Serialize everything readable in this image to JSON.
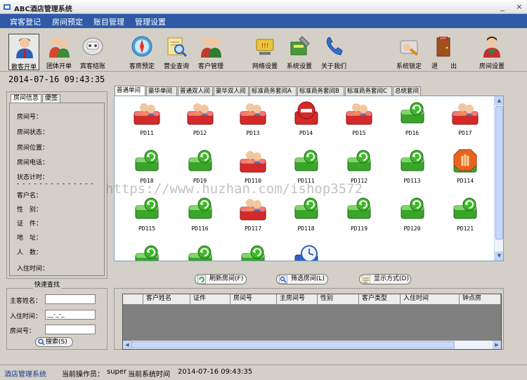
{
  "window": {
    "title": "ABC酒店管理系统",
    "minimize": "_",
    "close": "×"
  },
  "menu": [
    "宾客登记",
    "房间预定",
    "账目管理",
    "管理设置"
  ],
  "toolbar": [
    {
      "label": "散客开单",
      "icon": "walkin-guest-icon"
    },
    {
      "label": "团体开单",
      "icon": "group-guest-icon"
    },
    {
      "label": "宾客结账",
      "icon": "checkout-icon"
    },
    {
      "label": "客房预定",
      "icon": "compass-icon"
    },
    {
      "label": "营业查询",
      "icon": "search-report-icon"
    },
    {
      "label": "客户管理",
      "icon": "customer-icon"
    },
    {
      "label": "网络设置",
      "icon": "network-icon"
    },
    {
      "label": "系统设置",
      "icon": "settings-icon"
    },
    {
      "label": "关于我们",
      "icon": "info-icon"
    },
    {
      "label": "系统锁定",
      "icon": "lock-icon"
    },
    {
      "label": "退　　出",
      "icon": "exit-icon"
    },
    {
      "label": "房间设置",
      "icon": "room-settings-icon"
    }
  ],
  "datetime": "2014-07-16 09:43:35",
  "left_tabs": [
    "房间信息",
    "便签"
  ],
  "room_info_fields": [
    "房间号：",
    "房间状态：",
    "房间位置：",
    "房间电话：",
    "状态计时："
  ],
  "separator": "- - - - - - - - - - - - - -",
  "guest_info_fields": [
    "客户名：",
    "性　别：",
    "证　件：",
    "地　址：",
    "人　数：",
    "入住时间："
  ],
  "quick_search": {
    "title": "快速查找",
    "fields": [
      {
        "label": "主客姓名：",
        "value": ""
      },
      {
        "label": "入住时间：",
        "value": "__-_-_"
      },
      {
        "label": "房间号：",
        "value": ""
      }
    ],
    "button": "搜索(S)"
  },
  "room_tabs": [
    "普通单间",
    "豪华单间",
    "普通双人间",
    "豪华双人间",
    "标准商务套间A",
    "标准商务套间B",
    "标准商务套间C",
    "总统套间"
  ],
  "rooms": [
    {
      "id": "PD11",
      "status": "occupied"
    },
    {
      "id": "PD12",
      "status": "occupied"
    },
    {
      "id": "PD13",
      "status": "occupied"
    },
    {
      "id": "PD14",
      "status": "blocked"
    },
    {
      "id": "PD15",
      "status": "occupied"
    },
    {
      "id": "PD16",
      "status": "vacant"
    },
    {
      "id": "PD17",
      "status": "occupied"
    },
    {
      "id": "PD18",
      "status": "vacant"
    },
    {
      "id": "PD19",
      "status": "vacant"
    },
    {
      "id": "PD110",
      "status": "occupied"
    },
    {
      "id": "PD111",
      "status": "vacant"
    },
    {
      "id": "PD112",
      "status": "vacant"
    },
    {
      "id": "PD113",
      "status": "vacant"
    },
    {
      "id": "PD114",
      "status": "stop"
    },
    {
      "id": "PD115",
      "status": "vacant"
    },
    {
      "id": "PD116",
      "status": "vacant"
    },
    {
      "id": "PD117",
      "status": "occupied"
    },
    {
      "id": "PD118",
      "status": "vacant"
    },
    {
      "id": "PD119",
      "status": "vacant"
    },
    {
      "id": "PD120",
      "status": "vacant"
    },
    {
      "id": "PD121",
      "status": "vacant"
    },
    {
      "id": "",
      "status": "vacant"
    },
    {
      "id": "",
      "status": "vacant"
    },
    {
      "id": "",
      "status": "vacant"
    },
    {
      "id": "",
      "status": "reserved"
    }
  ],
  "actions": [
    {
      "label": "刷新房间(F)"
    },
    {
      "label": "筛选房间(L)"
    },
    {
      "label": "显示方式(D)"
    }
  ],
  "guest_table_headers": [
    "客户姓名",
    "证件",
    "房间号",
    "主房间号",
    "性别",
    "客户类型",
    "入住时间",
    "钟点房"
  ],
  "status": {
    "app": "酒店管理系统",
    "operator_label": "当前操作员：",
    "operator": "super",
    "time_label": "当前系统时间",
    "time": "2014-07-16 09:43:35"
  },
  "watermark": "https://www.huzhan.com/ishop3572",
  "colors": {
    "menubar": "#2e5aa8",
    "vacant": "#3aa52a",
    "occupied": "#d42a2a"
  }
}
